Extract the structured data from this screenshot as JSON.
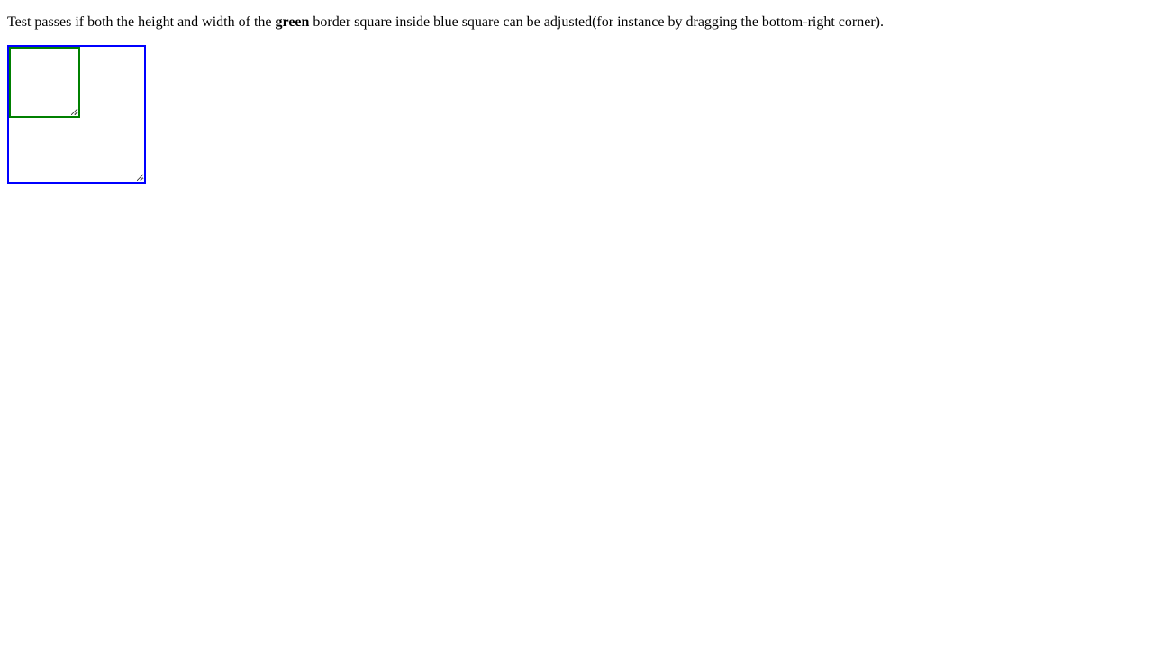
{
  "instructions": {
    "prefix": "Test passes if both the height and width of the ",
    "emphasis": "green",
    "suffix": " border square inside blue square can be adjusted(for instance by dragging the bottom-right corner)."
  },
  "colors": {
    "outer_border": "#0000ff",
    "inner_border": "#008000",
    "grip": "#808080"
  },
  "icons": {
    "resize_handle": "resize-grip-icon"
  }
}
